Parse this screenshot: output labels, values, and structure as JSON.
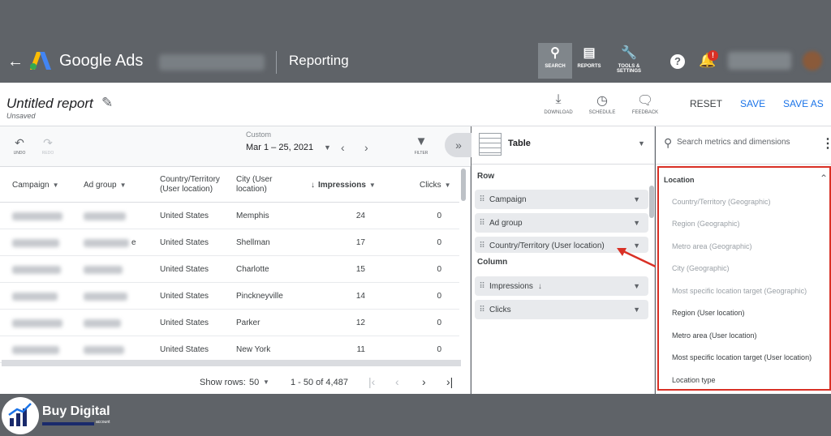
{
  "header": {
    "brand": "Google Ads",
    "page_name": "Reporting",
    "search_label": "SEARCH",
    "reports_label": "REPORTS",
    "tools_label_line1": "TOOLS &",
    "tools_label_line2": "SETTINGS",
    "help_glyph": "?",
    "notification_count": "!"
  },
  "title_bar": {
    "title": "Untitled report",
    "status": "Unsaved",
    "download_label": "DOWNLOAD",
    "schedule_label": "SCHEDULE",
    "feedback_label": "FEEDBACK",
    "reset_label": "RESET",
    "save_label": "SAVE",
    "save_as_label": "SAVE AS"
  },
  "toolbar": {
    "undo_label": "UNDO",
    "redo_label": "REDO",
    "date_range_label": "Custom",
    "date_range_value": "Mar 1 – 25, 2021",
    "filter_label": "FILTER"
  },
  "table": {
    "columns": [
      {
        "label": "Campaign"
      },
      {
        "label": "Ad group"
      },
      {
        "label": "Country/Territory (User location)"
      },
      {
        "label": "City (User location)"
      },
      {
        "label": "Impressions"
      },
      {
        "label": "Clicks"
      }
    ],
    "rows": [
      {
        "country": "United States",
        "city": "Memphis",
        "impressions": "24",
        "clicks": "0"
      },
      {
        "country": "United States",
        "city": "Shellman",
        "impressions": "17",
        "clicks": "0"
      },
      {
        "country": "United States",
        "city": "Charlotte",
        "impressions": "15",
        "clicks": "0"
      },
      {
        "country": "United States",
        "city": "Pinckneyville",
        "impressions": "14",
        "clicks": "0"
      },
      {
        "country": "United States",
        "city": "Parker",
        "impressions": "12",
        "clicks": "0"
      },
      {
        "country": "United States",
        "city": "New York",
        "impressions": "11",
        "clicks": "0"
      }
    ],
    "partial_text_row2": "e"
  },
  "pagination": {
    "show_rows_label": "Show rows:",
    "rows_per_page": "50",
    "range_text": "1 - 50 of 4,487"
  },
  "editor": {
    "view_type": "Table",
    "row_section_label": "Row",
    "row_chips": [
      "Campaign",
      "Ad group",
      "Country/Territory (User location)"
    ],
    "column_section_label": "Column",
    "column_chips": [
      "Impressions",
      "Clicks"
    ]
  },
  "metrics_panel": {
    "search_placeholder": "Search metrics and dimensions",
    "location_header": "Location",
    "location_items": [
      {
        "label": "Country/Territory (Geographic)",
        "enabled": false
      },
      {
        "label": "Region (Geographic)",
        "enabled": false
      },
      {
        "label": "Metro area (Geographic)",
        "enabled": false
      },
      {
        "label": "City (Geographic)",
        "enabled": false
      },
      {
        "label": "Most specific location target (Geographic)",
        "enabled": false
      },
      {
        "label": "Region (User location)",
        "enabled": true
      },
      {
        "label": "Metro area (User location)",
        "enabled": true
      },
      {
        "label": "Most specific location target (User location)",
        "enabled": true
      },
      {
        "label": "Location type",
        "enabled": true
      }
    ]
  },
  "watermark": {
    "name": "Buy Digital",
    "sub": "account"
  },
  "colors": {
    "header_bg": "#5f6368",
    "accent_blue": "#1a73e8",
    "highlight_red": "#d93025"
  }
}
